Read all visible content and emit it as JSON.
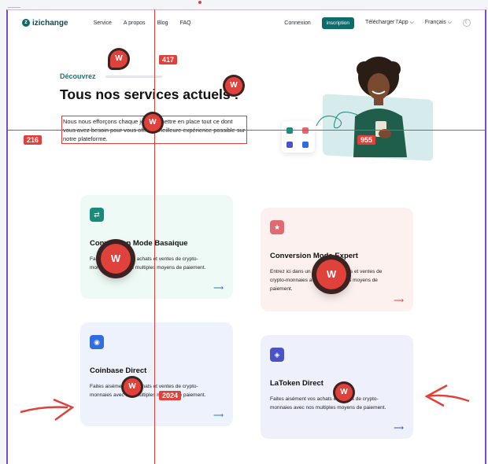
{
  "header": {
    "logo_text": "izichange",
    "nav": [
      "Service",
      "A propos",
      "Blog",
      "FAQ"
    ],
    "connexion": "Connexion",
    "inscription": "inscription",
    "download_app": "Télécharger l'App ⌵",
    "language": "Français ⌵",
    "theme_icon": "moon-icon"
  },
  "hero": {
    "eyebrow": "Découvrez",
    "title": "Tous nos services actuels :",
    "description": "Nous nous efforçons chaque jour de mettre en place tout ce dont vous avez besoin pour vous offrir la meilleure expérience possible sur notre plateforme."
  },
  "cards": [
    {
      "title": "Conversion Mode Basaique",
      "description": "Faites aisément vos achats et ventes de crypto-monnaies avec nos multiples moyens de paiement.",
      "icon": "convert-icon",
      "bg": "#eefaf5",
      "icon_bg": "#1a8a7a",
      "arrow_color": "#2a7ab8"
    },
    {
      "title": "Conversion Mode Expert",
      "description": "Entrez ici dans un marché de achats et ventes de crypto-monnaies avec nos multiples moyens de paiement.",
      "icon": "star-icon",
      "bg": "#fdf1ef",
      "icon_bg": "#e06a70",
      "arrow_color": "#e0413a"
    },
    {
      "title": "Coinbase Direct",
      "description": "Faites aisément vos achats et ventes de crypto-monnaies avec nos multiples moyens de paiement.",
      "icon": "coinbase-icon",
      "bg": "#eef2fc",
      "icon_bg": "#2f6de0",
      "arrow_color": "#2a7ab8"
    },
    {
      "title": "LaToken Direct",
      "description": "Faites aisément vos achats et ventes de crypto-monnaies avec nos multiples moyens de paiement.",
      "icon": "latoken-icon",
      "bg": "#eef0fb",
      "icon_bg": "#4a52c8",
      "arrow_color": "#2a5ab8"
    }
  ],
  "overlays": {
    "marker_letter": "W",
    "tags": [
      "417",
      "216",
      "955",
      "2024"
    ],
    "accent": "#e0413a"
  }
}
